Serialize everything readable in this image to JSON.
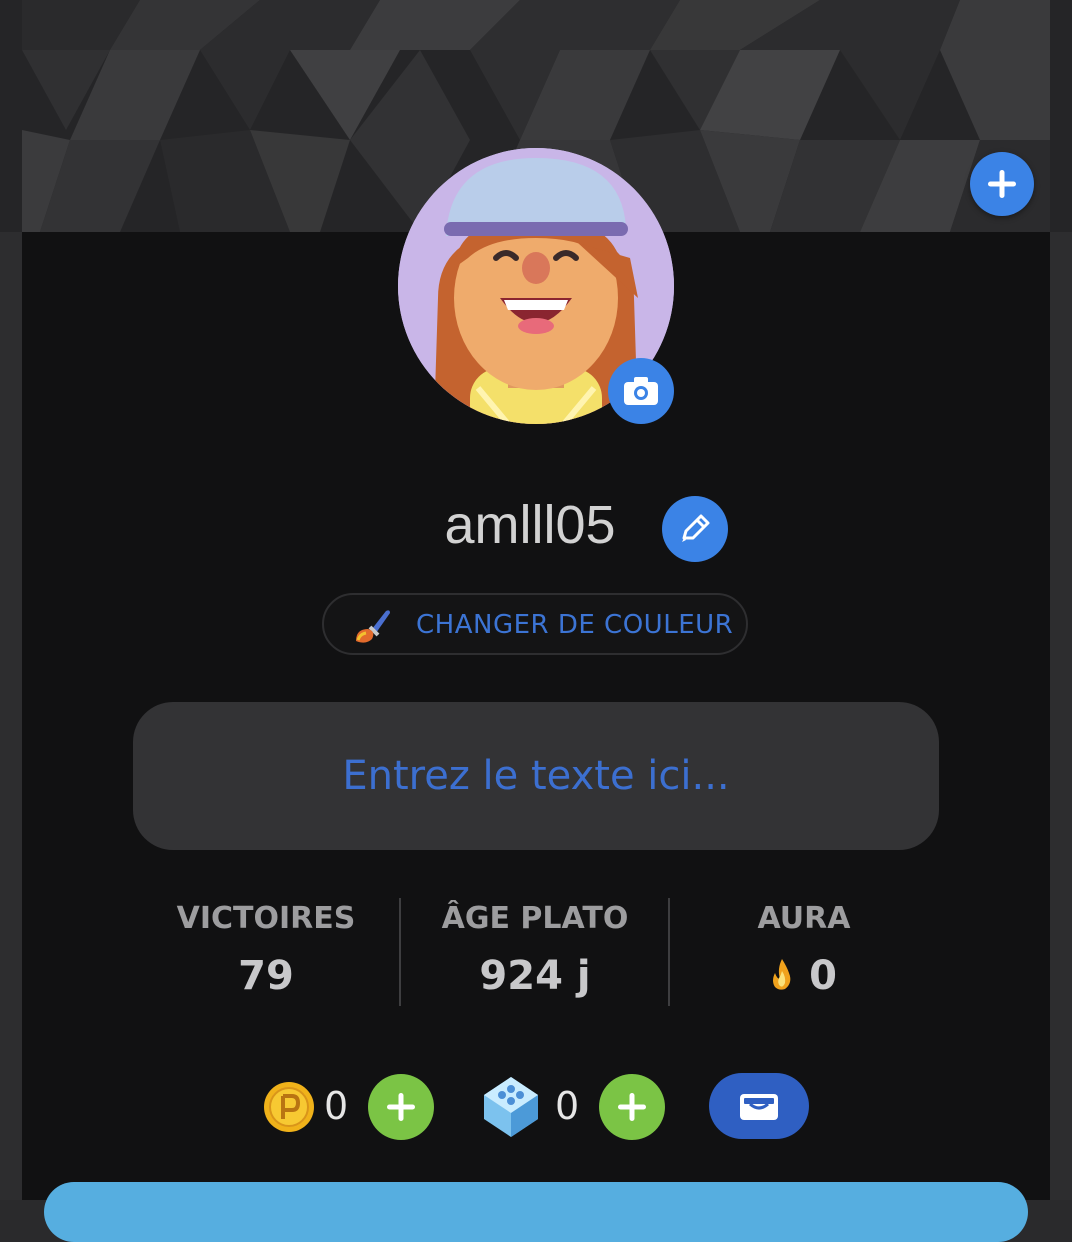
{
  "profile": {
    "username": "amlll05",
    "change_color_label": "CHANGER DE COULEUR",
    "bio_placeholder": "Entrez le texte ici..."
  },
  "stats": [
    {
      "label": "VICTOIRES",
      "value": "79"
    },
    {
      "label": "ÂGE PLATO",
      "value": "924 j"
    },
    {
      "label": "AURA",
      "value": "0",
      "icon": "flame-icon"
    }
  ],
  "currencies": {
    "coins": {
      "value": "0",
      "icon": "coin-icon"
    },
    "gems": {
      "value": "0",
      "icon": "gem-icon"
    }
  },
  "colors": {
    "accent_blue": "#3b83e6",
    "plus_green": "#7bc445",
    "wallet_blue": "#2f5fc2",
    "panel_bg": "#111112"
  }
}
